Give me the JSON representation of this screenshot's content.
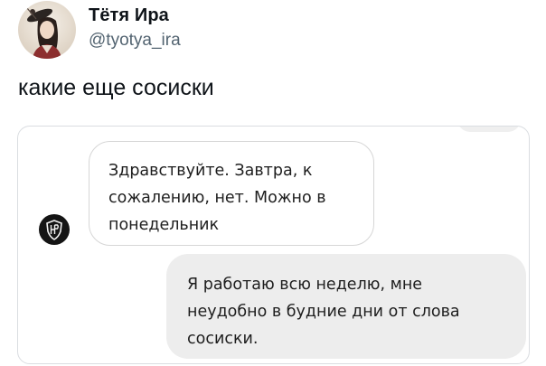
{
  "tweet": {
    "author": {
      "display_name": "Тётя Ира",
      "handle": "@tyotya_ira",
      "avatar_icon": "woman-with-fascinator-portrait"
    },
    "text": "какие еще сосиски"
  },
  "media": {
    "chat": {
      "incoming_avatar_icon": "shield-logo-icon",
      "messages": [
        {
          "direction": "incoming",
          "lines": [
            "Здравствуйте. Завтра, к",
            "сожалению, нет. Можно в",
            "понедельник"
          ]
        },
        {
          "direction": "outgoing",
          "lines": [
            "Я работаю всю неделю, мне",
            "неудобно в будние дни от слова",
            "сосиски."
          ]
        }
      ]
    }
  },
  "colors": {
    "text_primary": "#0f1419",
    "text_secondary": "#536471",
    "incoming_bubble_bg": "#ffffff",
    "incoming_bubble_border": "#d6d6d6",
    "outgoing_bubble_bg": "#ededed",
    "chat_avatar_bg": "#141414"
  }
}
